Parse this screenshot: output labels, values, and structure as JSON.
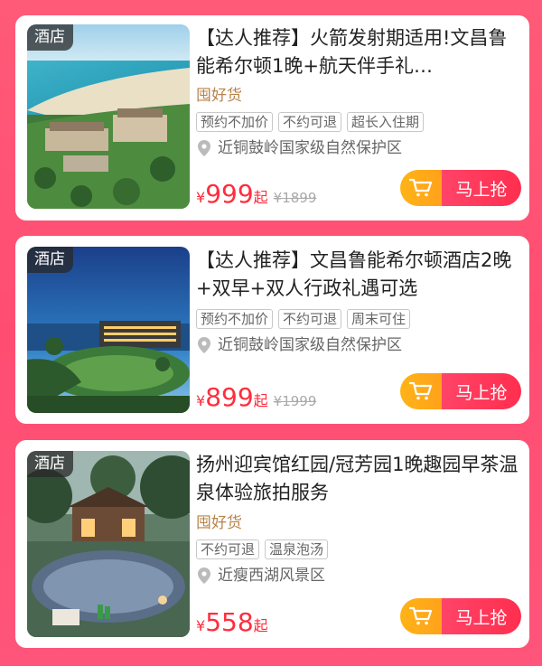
{
  "products": [
    {
      "badge": "酒店",
      "title": "【达人推荐】火箭发射期适用!文昌鲁能希尔顿1晚+航天伴手礼…",
      "brand": "囤好货",
      "tags": [
        "预约不加价",
        "不约可退",
        "超长入住期"
      ],
      "location": "近铜鼓岭国家级自然保护区",
      "currency": "¥",
      "price": "999",
      "price_suffix": "起",
      "original_price": "¥1899",
      "buy_label": "马上抢"
    },
    {
      "badge": "酒店",
      "title": "【达人推荐】文昌鲁能希尔顿酒店2晚+双早+双人行政礼遇可选",
      "tags": [
        "预约不加价",
        "不约可退",
        "周末可住"
      ],
      "location": "近铜鼓岭国家级自然保护区",
      "currency": "¥",
      "price": "899",
      "price_suffix": "起",
      "original_price": "¥1999",
      "buy_label": "马上抢"
    },
    {
      "badge": "酒店",
      "title": "扬州迎宾馆红园/冠芳园1晚趣园早茶温泉体验旅拍服务",
      "brand": "囤好货",
      "tags": [
        "不约可退",
        "温泉泡汤"
      ],
      "location": "近瘦西湖风景区",
      "currency": "¥",
      "price": "558",
      "price_suffix": "起",
      "buy_label": "马上抢"
    }
  ],
  "colors": {
    "background": "#ff5a78",
    "price": "#ff2d3d",
    "brand": "#b7834a",
    "button_left": "#ffb318",
    "button_right": "#ff3456"
  },
  "icons": [
    "location-pin-icon",
    "shopping-cart-icon"
  ]
}
